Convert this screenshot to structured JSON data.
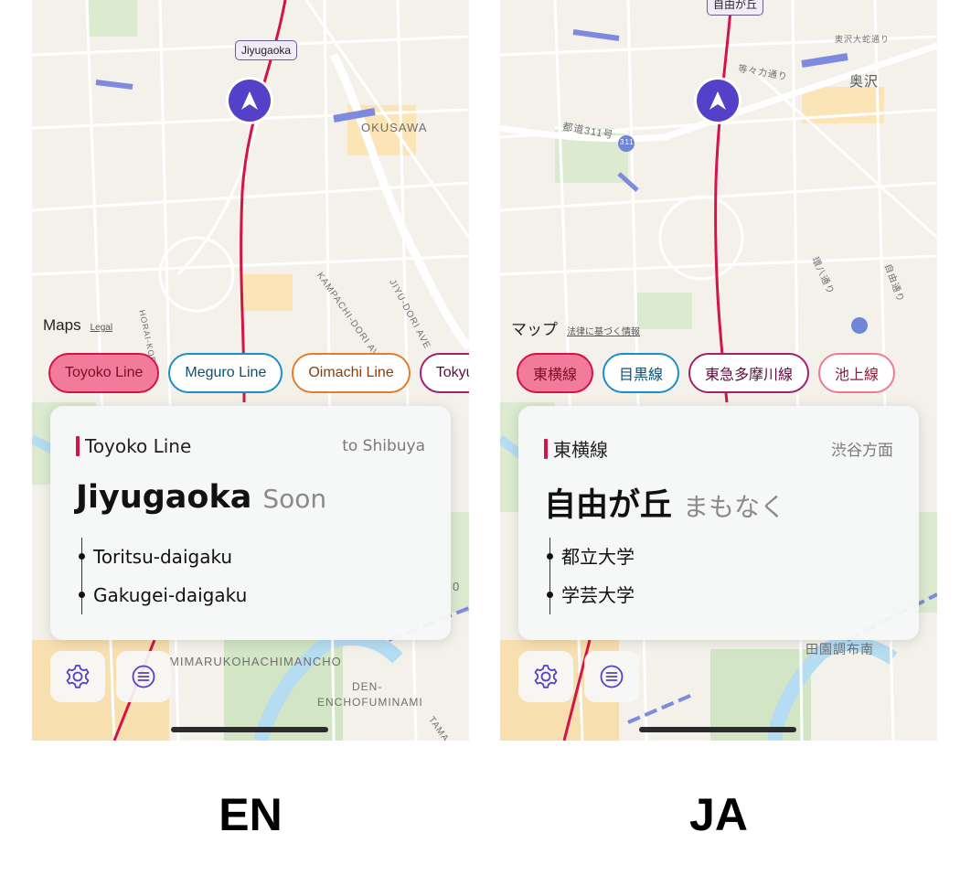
{
  "colors": {
    "toyoko": "#d41346",
    "meguro": "#1a8fc7",
    "oimachi": "#e37d2b",
    "tokyu_tamagawa": "#a0216e",
    "ikegami": "#ee7a97",
    "nav_marker": "#5541c8"
  },
  "en": {
    "map": {
      "attribution_brand": "Maps",
      "attribution_legal": "Legal",
      "station_callout": "Jiyugaoka",
      "labels": [
        "OKUSAWA",
        "HORAI-KOE",
        "KAMPACHI-DORI AVE",
        "JIYU-DORI AVE",
        "MIMARUKOHACHIMANCHO",
        "DEN-",
        "ENCHOFUMINAMI",
        "TAMA",
        "0"
      ]
    },
    "lines": [
      {
        "label": "Toyoko Line",
        "color": "#d41346",
        "active": true
      },
      {
        "label": "Meguro Line",
        "color": "#1a8fc7",
        "active": false
      },
      {
        "label": "Oimachi Line",
        "color": "#e37d2b",
        "active": false
      },
      {
        "label": "Tokyu-Tama",
        "color": "#a0216e",
        "active": false
      }
    ],
    "card": {
      "line_name": "Toyoko Line",
      "direction": "to Shibuya",
      "station": "Jiyugaoka",
      "status": "Soon",
      "next_stops": [
        "Toritsu-daigaku",
        "Gakugei-daigaku"
      ]
    },
    "caption": "EN"
  },
  "ja": {
    "map": {
      "attribution_brand": "マップ",
      "attribution_legal": "法律に基づく情報",
      "station_callout": "自由が丘",
      "labels": [
        "奥沢大蛇通り",
        "等々力通り",
        "奥沢",
        "都道311号",
        "311",
        "環八通り",
        "自由通り",
        "田園調布南"
      ]
    },
    "lines": [
      {
        "label": "東横線",
        "color": "#d41346",
        "active": true
      },
      {
        "label": "目黒線",
        "color": "#1a8fc7",
        "active": false
      },
      {
        "label": "東急多摩川線",
        "color": "#a0216e",
        "active": false
      },
      {
        "label": "池上線",
        "color": "#ee7a97",
        "active": false
      }
    ],
    "card": {
      "line_name": "東横線",
      "direction": "渋谷方面",
      "station": "自由が丘",
      "status": "まもなく",
      "next_stops": [
        "都立大学",
        "学芸大学"
      ]
    },
    "caption": "JA"
  }
}
